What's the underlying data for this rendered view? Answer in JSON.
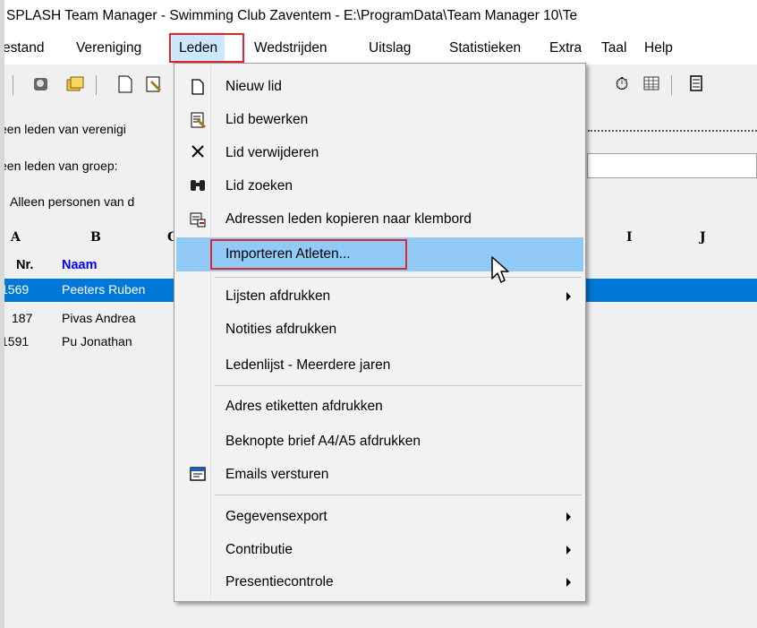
{
  "window": {
    "title": "SPLASH Team Manager - Swimming Club Zaventem - E:\\ProgramData\\Team Manager 10\\Te"
  },
  "menubar": {
    "items": [
      {
        "label": "estand"
      },
      {
        "label": "Vereniging"
      },
      {
        "label": "Leden"
      },
      {
        "label": "Wedstrijden"
      },
      {
        "label": "Uitslag"
      },
      {
        "label": "Statistieken"
      },
      {
        "label": "Extra"
      },
      {
        "label": "Taal"
      },
      {
        "label": "Help"
      }
    ]
  },
  "toolbar": {
    "icons": [
      "tool-icon",
      "members-icon",
      "folders-icon",
      "new-document-icon",
      "edit-document-icon",
      "stopwatch-icon",
      "table-icon",
      "calculator-icon"
    ]
  },
  "filters": {
    "club_label": "een leden van verenigi",
    "group_label": "een leden van groep:",
    "persons_label": "Alleen personen van d"
  },
  "grid": {
    "column_letters": [
      "A",
      "B",
      "C",
      "I",
      "J"
    ],
    "headers": {
      "nr": "Nr.",
      "naam": "Naam"
    },
    "rows": [
      {
        "nr": "1569",
        "naam": "Peeters Ruben"
      },
      {
        "nr": "187",
        "naam": "Pivas Andrea"
      },
      {
        "nr": "1591",
        "naam": "Pu Jonathan"
      }
    ]
  },
  "dropdown": {
    "items": [
      {
        "label": "Nieuw lid",
        "icon": "new-document-icon"
      },
      {
        "label": "Lid bewerken",
        "icon": "edit-member-icon"
      },
      {
        "label": "Lid verwijderen",
        "icon": "delete-x-icon"
      },
      {
        "label": "Lid zoeken",
        "icon": "binoculars-icon"
      },
      {
        "label": "Adressen leden kopieren naar klembord",
        "icon": "clipboard-address-icon"
      },
      {
        "label": "Importeren Atleten...",
        "icon": ""
      },
      {
        "label": "Lijsten afdrukken",
        "icon": ""
      },
      {
        "label": "Notities afdrukken",
        "icon": ""
      },
      {
        "label": "Ledenlijst - Meerdere jaren",
        "icon": ""
      },
      {
        "label": "Adres etiketten afdrukken",
        "icon": ""
      },
      {
        "label": "Beknopte brief A4/A5 afdrukken",
        "icon": ""
      },
      {
        "label": "Emails versturen",
        "icon": "email-send-icon"
      },
      {
        "label": "Gegevensexport",
        "icon": ""
      },
      {
        "label": "Contributie",
        "icon": ""
      },
      {
        "label": "Presentiecontrole",
        "icon": ""
      }
    ]
  },
  "colors": {
    "selection": "#0078d7",
    "hover": "#91c9f7",
    "highlight": "#e0262a",
    "naam_header": "#0000ff"
  }
}
